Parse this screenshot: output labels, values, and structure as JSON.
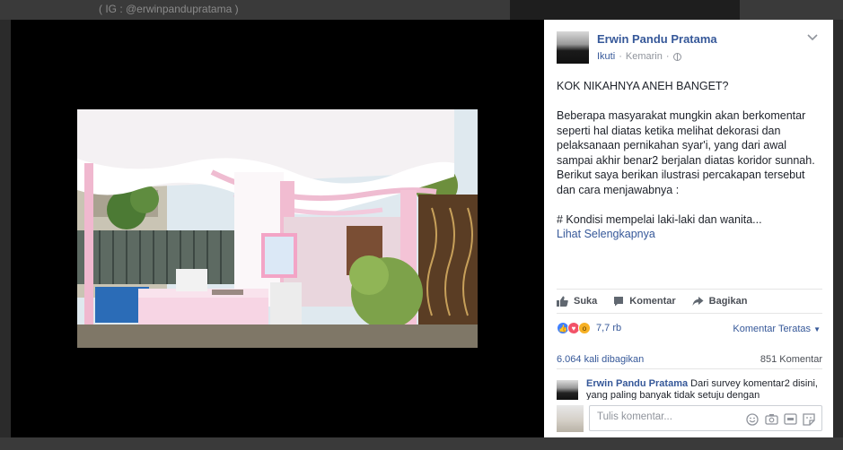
{
  "background": {
    "top_text": "( IG : @erwinpandupratama )"
  },
  "post": {
    "author": "Erwin Pandu Pratama",
    "follow_label": "Ikuti",
    "separator": "·",
    "time": "Kemarin",
    "paragraphs": [
      "KOK NIKAHNYA ANEH BANGET?",
      "Beberapa masyarakat mungkin akan berkomentar seperti hal diatas ketika melihat dekorasi dan pelaksanaan pernikahan syar'i, yang dari awal sampai akhir benar2 berjalan diatas koridor sunnah. Berikut saya berikan ilustrasi percakapan tersebut dan cara menjawabnya :",
      "# Kondisi mempelai laki-laki dan wanita..."
    ],
    "see_more": "Lihat Selengkapnya"
  },
  "actions": {
    "like": "Suka",
    "comment": "Komentar",
    "share": "Bagikan"
  },
  "reactions": {
    "count": "7,7 rb",
    "types": [
      "like-icon",
      "love-icon",
      "wow-icon"
    ],
    "sort_label": "Komentar Teratas"
  },
  "stats": {
    "shares": "6.064 kali dibagikan",
    "comments": "851 Komentar"
  },
  "top_comment": {
    "author": "Erwin Pandu Pratama",
    "text": "Dari survey komentar2 disini, yang paling banyak tidak setuju dengan"
  },
  "composer": {
    "placeholder": "Tulis komentar..."
  },
  "colors": {
    "link": "#365899",
    "text": "#1d2129",
    "muted": "#90949c"
  }
}
